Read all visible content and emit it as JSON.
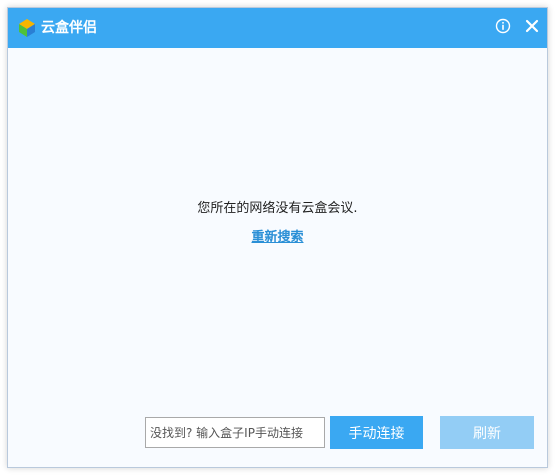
{
  "window": {
    "title": "云盒伴侣",
    "info_icon": "info-icon",
    "close_icon": "close-icon",
    "accent_color": "#3aa8f2"
  },
  "main": {
    "message": "您所在的网络没有云盒会议.",
    "research_link": "重新搜索"
  },
  "footer": {
    "ip_input_value": "",
    "ip_input_placeholder": "没找到? 输入盒子IP手动连接",
    "connect_label": "手动连接",
    "refresh_label": "刷新",
    "refresh_color": "#93cdf5"
  }
}
